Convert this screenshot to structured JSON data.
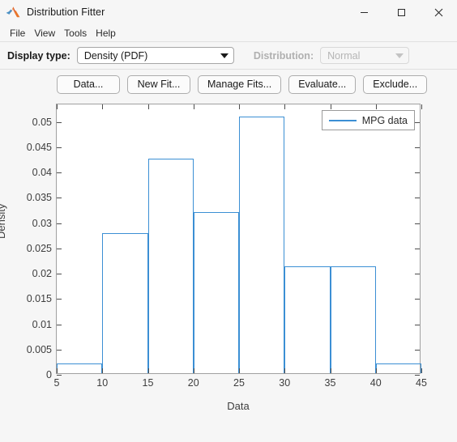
{
  "window": {
    "title": "Distribution Fitter",
    "icon": "matlab-membrane-icon",
    "minimize_label": "–",
    "maximize_label": "□",
    "close_label": "✕"
  },
  "menubar": {
    "items": [
      {
        "label": "File"
      },
      {
        "label": "View"
      },
      {
        "label": "Tools"
      },
      {
        "label": "Help"
      }
    ]
  },
  "toolbar": {
    "display_type_label": "Display type:",
    "display_type_value": "Density (PDF)",
    "distribution_label": "Distribution:",
    "distribution_value": "Normal",
    "distribution_disabled": true
  },
  "buttons": [
    {
      "label": "Data..."
    },
    {
      "label": "New Fit..."
    },
    {
      "label": "Manage Fits..."
    },
    {
      "label": "Evaluate..."
    },
    {
      "label": "Exclude..."
    }
  ],
  "chart_data": {
    "type": "bar",
    "title": "",
    "xlabel": "Data",
    "ylabel": "Density",
    "xlim": [
      5,
      45
    ],
    "ylim": [
      0,
      0.0535
    ],
    "xticks": [
      5,
      10,
      15,
      20,
      25,
      30,
      35,
      40,
      45
    ],
    "xticklabels": [
      "5",
      "10",
      "15",
      "20",
      "25",
      "30",
      "35",
      "40",
      "45"
    ],
    "yticks": [
      0,
      0.005,
      0.01,
      0.015,
      0.02,
      0.025,
      0.03,
      0.035,
      0.04,
      0.045,
      0.05
    ],
    "yticklabels": [
      "0",
      "0.005",
      "0.01",
      "0.015",
      "0.02",
      "0.025",
      "0.03",
      "0.035",
      "0.04",
      "0.045",
      "0.05"
    ],
    "grid": false,
    "legend": {
      "position": "top-right",
      "entries": [
        "MPG data"
      ]
    },
    "series": [
      {
        "name": "MPG data",
        "color": "#3b8fd4",
        "bin_edges": [
          5,
          10,
          15,
          20,
          25,
          30,
          35,
          40,
          45
        ],
        "categories": [
          "5-10",
          "10-15",
          "15-20",
          "20-25",
          "25-30",
          "30-35",
          "35-40",
          "40-45"
        ],
        "values": [
          0.002,
          0.0277,
          0.0425,
          0.0318,
          0.0508,
          0.0212,
          0.0212,
          0.002
        ]
      }
    ]
  }
}
